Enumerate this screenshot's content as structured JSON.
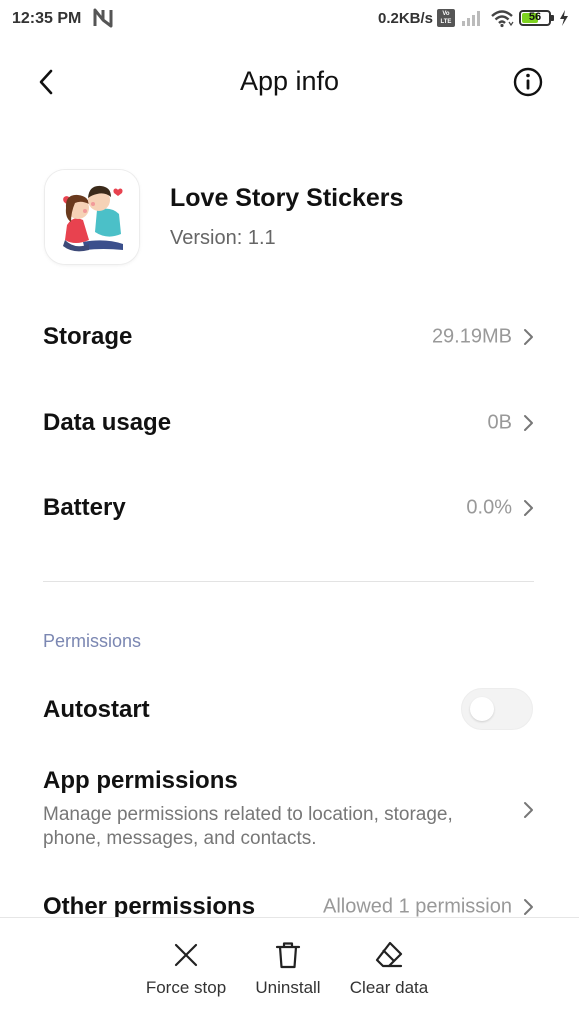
{
  "status_bar": {
    "time": "12:35 PM",
    "network_speed": "0.2KB/s",
    "volte": "Vo LTE",
    "battery": "56"
  },
  "header": {
    "title": "App info"
  },
  "app": {
    "name": "Love Story Stickers",
    "version": "Version: 1.1"
  },
  "rows": [
    {
      "label": "Storage",
      "value": "29.19MB"
    },
    {
      "label": "Data usage",
      "value": "0B"
    },
    {
      "label": "Battery",
      "value": "0.0%"
    }
  ],
  "permissions": {
    "section_title": "Permissions",
    "autostart_label": "Autostart",
    "autostart_enabled": false,
    "app_permissions_title": "App permissions",
    "app_permissions_desc": "Manage permissions related to location, storage, phone, messages, and contacts.",
    "other_permissions_label": "Other permissions",
    "other_permissions_value": "Allowed 1 permission"
  },
  "actions": [
    {
      "label": "Force stop",
      "icon": "close-x-icon"
    },
    {
      "label": "Uninstall",
      "icon": "trash-icon"
    },
    {
      "label": "Clear data",
      "icon": "eraser-icon"
    }
  ],
  "colors": {
    "section_title": "#7b87b2",
    "battery_fill": "#7ed321"
  }
}
